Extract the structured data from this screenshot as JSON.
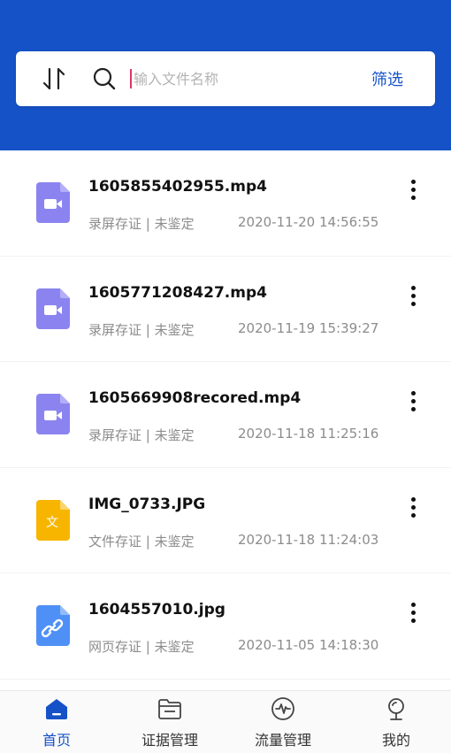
{
  "search": {
    "placeholder": "输入文件名称",
    "filter_label": "筛选"
  },
  "files": [
    {
      "name": "1605855402955.mp4",
      "category": "录屏存证 | 未鉴定",
      "time": "2020-11-20 14:56:55",
      "type": "video"
    },
    {
      "name": "1605771208427.mp4",
      "category": "录屏存证 | 未鉴定",
      "time": "2020-11-19 15:39:27",
      "type": "video"
    },
    {
      "name": "1605669908recored.mp4",
      "category": "录屏存证 | 未鉴定",
      "time": "2020-11-18 11:25:16",
      "type": "video"
    },
    {
      "name": "IMG_0733.JPG",
      "category": "文件存证 | 未鉴定",
      "time": "2020-11-18 11:24:03",
      "type": "document",
      "icon_char": "文"
    },
    {
      "name": "1604557010.jpg",
      "category": "网页存证 | 未鉴定",
      "time": "2020-11-05 14:18:30",
      "type": "link"
    }
  ],
  "tabs": [
    {
      "label": "首页",
      "icon": "home-icon",
      "active": true
    },
    {
      "label": "证据管理",
      "icon": "folder-icon",
      "active": false
    },
    {
      "label": "流量管理",
      "icon": "pulse-icon",
      "active": false
    },
    {
      "label": "我的",
      "icon": "user-icon",
      "active": false
    }
  ],
  "colors": {
    "primary": "#1552c8",
    "video_icon": "#8b84f0",
    "document_icon": "#f7b500",
    "link_icon": "#4e90f5"
  }
}
